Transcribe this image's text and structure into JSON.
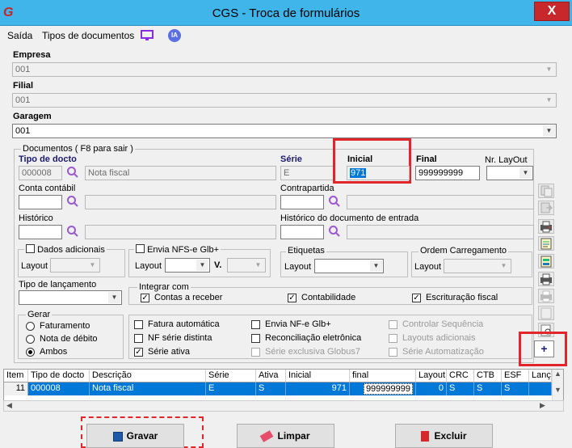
{
  "window": {
    "title": "CGS - Troca de formulários",
    "close_label": "X",
    "app_logo": "G"
  },
  "menu": {
    "saida": "Saída",
    "tipos": "Tipos de documentos",
    "ia": "IA"
  },
  "empresa": {
    "label": "Empresa",
    "value": "001"
  },
  "filial": {
    "label": "Filial",
    "value": "001"
  },
  "garagem": {
    "label": "Garagem",
    "value": "001"
  },
  "documentos": {
    "title": "Documentos ( F8 para sair )",
    "tipo_label": "Tipo de docto",
    "tipo_code": "000008",
    "tipo_desc": "Nota fiscal",
    "serie_label": "Série",
    "serie_value": "E",
    "inicial_label": "Inicial",
    "inicial_value": "971",
    "final_label": "Final",
    "final_value": "999999999",
    "layout_label": "Nr. LayOut",
    "conta_label": "Conta contábil",
    "contrapartida_label": "Contrapartida",
    "historico_label": "Histórico",
    "historico_entrada_label": "Histórico do documento de entrada"
  },
  "dados_adicionais": {
    "label": "Dados adicionais",
    "layout_label": "Layout"
  },
  "nfse": {
    "label": "Envia NFS-e Glb+",
    "layout_label": "Layout",
    "v_label": "V."
  },
  "etiquetas": {
    "label": "Etiquetas",
    "layout_label": "Layout"
  },
  "ordem": {
    "label": "Ordem Carregamento",
    "layout_label": "Layout"
  },
  "tipo_lancamento": {
    "label": "Tipo de lançamento"
  },
  "integrar": {
    "label": "Integrar com",
    "contas": "Contas a receber",
    "contabilidade": "Contabilidade",
    "escrituracao": "Escrituração fiscal"
  },
  "gerar": {
    "label": "Gerar",
    "faturamento": "Faturamento",
    "nota_debito": "Nota de débito",
    "ambos": "Ambos"
  },
  "options": {
    "fatura": "Fatura automática",
    "nf_serie": "NF série distinta",
    "serie_ativa": "Série ativa",
    "envia_nfe": "Envia NF-e Glb+",
    "reconciliacao": "Reconciliação eletrônica",
    "serie_exclusiva": "Série exclusiva Globus7",
    "controlar": "Controlar Sequência",
    "layouts": "Layouts adicionais",
    "serie_auto": "Série Automatização"
  },
  "add_button": "+",
  "grid": {
    "headers": [
      "Item",
      "Tipo de docto",
      "Descrição",
      "Série",
      "Ativa",
      "Inicial",
      "final",
      "Layout",
      "CRC",
      "CTB",
      "ESF",
      "Lanç"
    ],
    "row": [
      "11",
      "000008",
      "Nota fiscal",
      "E",
      "S",
      "971",
      "999999999",
      "0",
      "S",
      "S",
      "S",
      ""
    ]
  },
  "buttons": {
    "gravar": "Gravar",
    "limpar": "Limpar",
    "excluir": "Excluir"
  },
  "colors": {
    "titlebar": "#3fb5ea",
    "selection": "#0078d7",
    "highlight": "#e0262b"
  }
}
